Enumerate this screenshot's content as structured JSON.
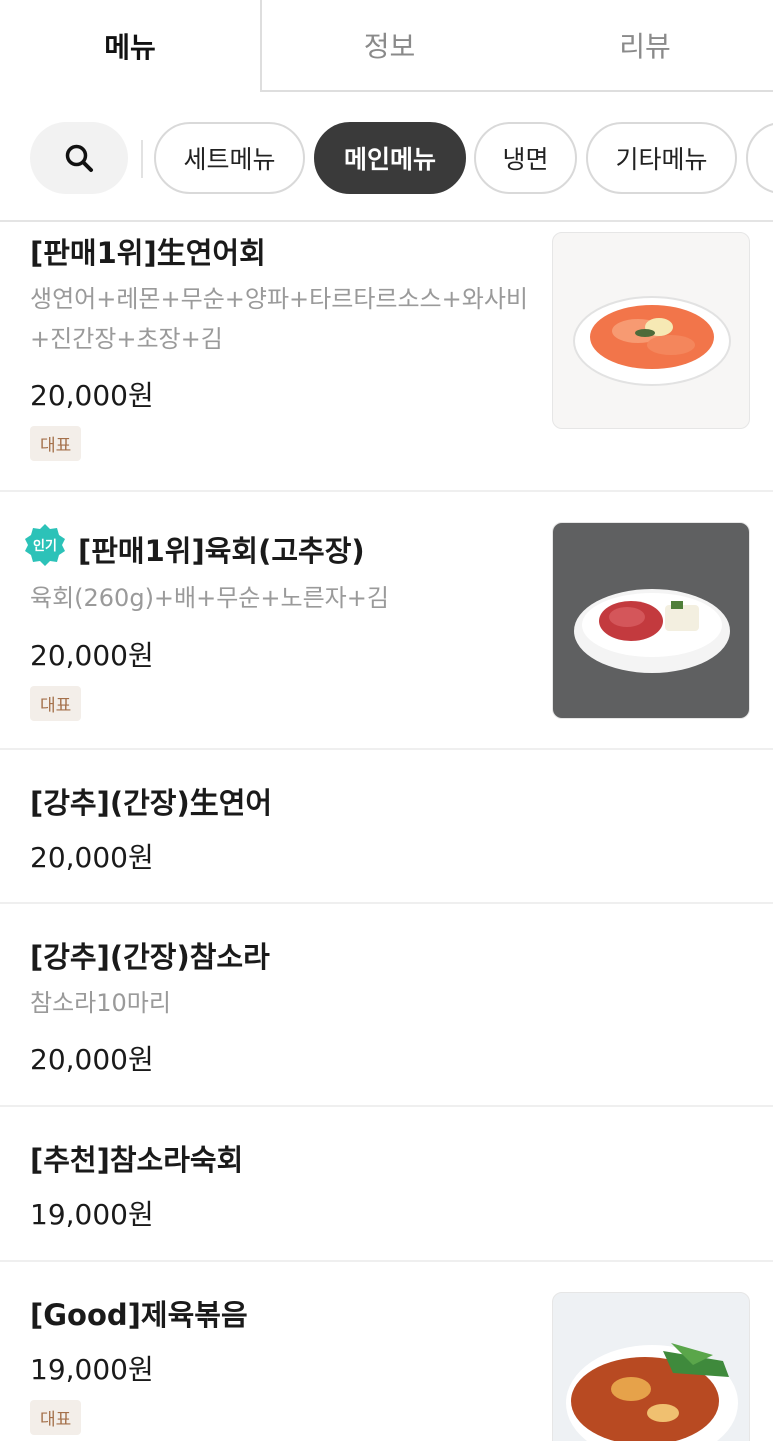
{
  "tabs": [
    {
      "label": "메뉴",
      "active": true
    },
    {
      "label": "정보",
      "active": false
    },
    {
      "label": "리뷰",
      "active": false
    }
  ],
  "search": {
    "icon": "search-icon"
  },
  "categories": [
    {
      "label": "세트메뉴",
      "active": false
    },
    {
      "label": "메인메뉴",
      "active": true
    },
    {
      "label": "냉면",
      "active": false
    },
    {
      "label": "기타메뉴",
      "active": false
    }
  ],
  "items": [
    {
      "name": "[판매1위]生연어회",
      "desc_line1": "생연어+레몬+무순+양파+타르타르소스+와사비",
      "desc_line2": "+진간장+초장+김",
      "price": "20,000원",
      "badge": "대표",
      "image": "salmon-sashimi-photo"
    },
    {
      "name": "[판매1위]육회(고추장)",
      "popular": "인기",
      "desc": "육회(260g)+배+무순+노른자+김",
      "price": "20,000원",
      "badge": "대표",
      "image": "yukhoe-photo"
    },
    {
      "name": "[강추](간장)生연어",
      "price": "20,000원"
    },
    {
      "name": "[강추](간장)참소라",
      "desc": "참소라10마리",
      "price": "20,000원"
    },
    {
      "name": "[추천]참소라숙회",
      "price": "19,000원"
    },
    {
      "name": "[Good]제육볶음",
      "price": "19,000원",
      "badge": "대표",
      "image": "jeyuk-bokkeum-photo"
    }
  ],
  "colors": {
    "active_chip": "#3a3a3a",
    "badge_bg": "#f3eee9",
    "badge_text": "#a4704a",
    "popular_badge": "#2cc2b8"
  }
}
